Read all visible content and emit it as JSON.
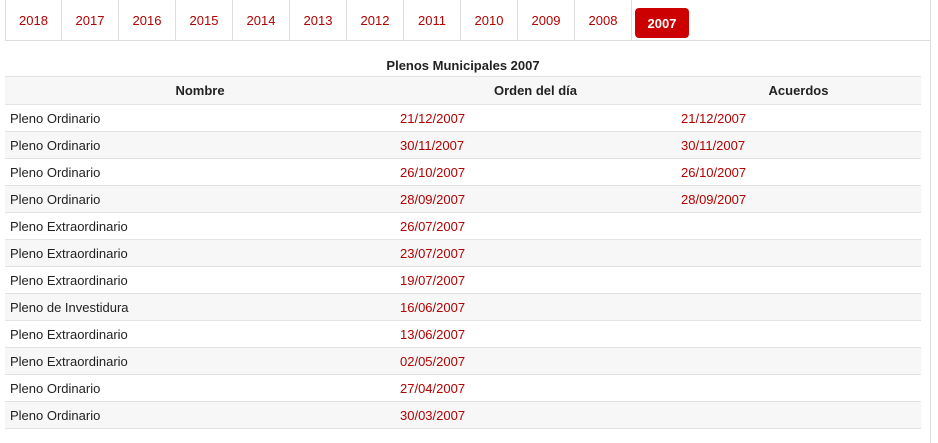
{
  "tabs": [
    {
      "label": "2018"
    },
    {
      "label": "2017"
    },
    {
      "label": "2016"
    },
    {
      "label": "2015"
    },
    {
      "label": "2014"
    },
    {
      "label": "2013"
    },
    {
      "label": "2012"
    },
    {
      "label": "2011"
    },
    {
      "label": "2010"
    },
    {
      "label": "2009"
    },
    {
      "label": "2008"
    },
    {
      "label": "2007"
    }
  ],
  "active_tab": "2007",
  "table": {
    "caption": "Plenos Municipales 2007",
    "headers": {
      "nombre": "Nombre",
      "orden": "Orden del día",
      "acuerdos": "Acuerdos"
    },
    "rows": [
      {
        "nombre": "Pleno Ordinario",
        "orden": "21/12/2007",
        "acuerdos": "21/12/2007"
      },
      {
        "nombre": "Pleno Ordinario",
        "orden": "30/11/2007",
        "acuerdos": "30/11/2007"
      },
      {
        "nombre": "Pleno Ordinario",
        "orden": "26/10/2007",
        "acuerdos": "26/10/2007"
      },
      {
        "nombre": "Pleno Ordinario",
        "orden": "28/09/2007",
        "acuerdos": "28/09/2007"
      },
      {
        "nombre": "Pleno Extraordinario",
        "orden": "26/07/2007",
        "acuerdos": ""
      },
      {
        "nombre": "Pleno Extraordinario",
        "orden": "23/07/2007",
        "acuerdos": ""
      },
      {
        "nombre": "Pleno Extraordinario",
        "orden": "19/07/2007",
        "acuerdos": ""
      },
      {
        "nombre": "Pleno de Investidura",
        "orden": "16/06/2007",
        "acuerdos": ""
      },
      {
        "nombre": "Pleno Extraordinario",
        "orden": "13/06/2007",
        "acuerdos": ""
      },
      {
        "nombre": "Pleno Extraordinario",
        "orden": "02/05/2007",
        "acuerdos": ""
      },
      {
        "nombre": "Pleno Ordinario",
        "orden": "27/04/2007",
        "acuerdos": ""
      },
      {
        "nombre": "Pleno Ordinario",
        "orden": "30/03/2007",
        "acuerdos": ""
      }
    ]
  },
  "colors": {
    "link": "#b20000",
    "active_tab_bg": "#cc0000",
    "active_tab_text": "#ffffff",
    "row_alt_bg": "#f7f7f7",
    "border": "#dddddd"
  }
}
